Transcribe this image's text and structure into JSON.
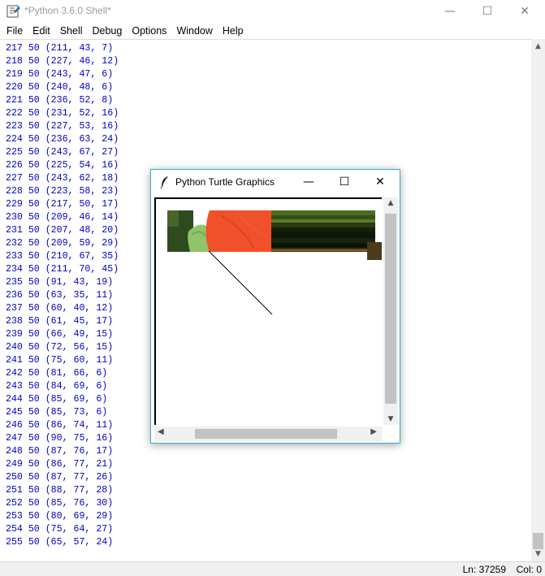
{
  "window": {
    "title": "*Python 3.6.0 Shell*",
    "minimize": "—",
    "maximize": "☐",
    "close": "✕"
  },
  "menu": [
    "File",
    "Edit",
    "Shell",
    "Debug",
    "Options",
    "Window",
    "Help"
  ],
  "lines": [
    "217 50 (211, 43, 7)",
    "218 50 (227, 46, 12)",
    "219 50 (243, 47, 6)",
    "220 50 (240, 48, 6)",
    "221 50 (236, 52, 8)",
    "222 50 (231, 52, 16)",
    "223 50 (227, 53, 16)",
    "224 50 (236, 63, 24)",
    "225 50 (243, 67, 27)",
    "226 50 (225, 54, 16)",
    "227 50 (243, 62, 18)",
    "228 50 (223, 58, 23)",
    "229 50 (217, 50, 17)",
    "230 50 (209, 46, 14)",
    "231 50 (207, 48, 20)",
    "232 50 (209, 59, 29)",
    "233 50 (210, 67, 35)",
    "234 50 (211, 70, 45)",
    "235 50 (91, 43, 19)",
    "236 50 (63, 35, 11)",
    "237 50 (60, 40, 12)",
    "238 50 (61, 45, 17)",
    "239 50 (66, 49, 15)",
    "240 50 (72, 56, 15)",
    "241 50 (75, 60, 11)",
    "242 50 (81, 66, 6)",
    "243 50 (84, 69, 6)",
    "244 50 (85, 69, 6)",
    "245 50 (85, 73, 6)",
    "246 50 (86, 74, 11)",
    "247 50 (90, 75, 16)",
    "248 50 (87, 76, 17)",
    "249 50 (86, 77, 21)",
    "250 50 (87, 77, 26)",
    "251 50 (88, 77, 28)",
    "252 50 (85, 76, 30)",
    "253 50 (80, 69, 29)",
    "254 50 (75, 64, 27)",
    "255 50 (65, 57, 24)"
  ],
  "status": {
    "ln": "Ln: 37259",
    "col": "Col: 0"
  },
  "turtle": {
    "title": "Python Turtle Graphics",
    "minimize": "—",
    "maximize": "☐",
    "close": "✕"
  },
  "colors": {
    "output_text": "#0000c8",
    "turtle_border": "#3aaad2"
  }
}
